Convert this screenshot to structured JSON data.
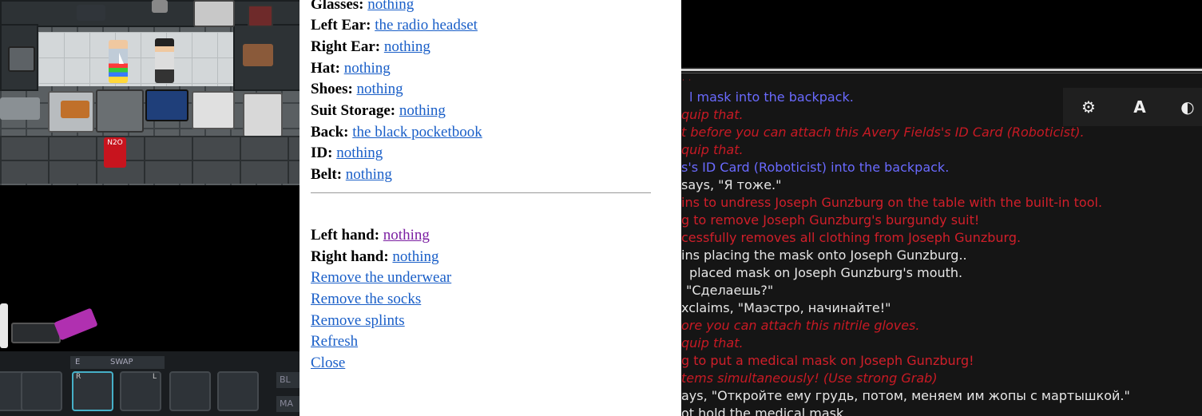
{
  "game": {
    "swap_key": "E",
    "swap_label": "SWAP",
    "tank_label": "N2O",
    "side_labels": [
      "BL",
      "MA"
    ],
    "slot_markers": [
      "R",
      "L"
    ]
  },
  "inventory": {
    "slots": [
      {
        "label": "Glasses:",
        "value": "nothing"
      },
      {
        "label": "Left Ear:",
        "value": "the radio headset"
      },
      {
        "label": "Right Ear:",
        "value": "nothing"
      },
      {
        "label": "Hat:",
        "value": "nothing"
      },
      {
        "label": "Shoes:",
        "value": "nothing"
      },
      {
        "label": "Suit Storage:",
        "value": "nothing"
      },
      {
        "label": "Back:",
        "value": "the black pocketbook"
      },
      {
        "label": "ID:",
        "value": "nothing"
      },
      {
        "label": "Belt:",
        "value": "nothing"
      }
    ],
    "hands": [
      {
        "label": "Left hand:",
        "value": "nothing"
      },
      {
        "label": "Right hand:",
        "value": "nothing"
      }
    ],
    "actions": [
      "Remove the underwear",
      "Remove the socks",
      "Remove splints",
      "Refresh",
      "Close"
    ]
  },
  "chat": {
    "toolbar": {
      "font_label": "A"
    },
    "lines": [
      {
        "text": "l mask into the backpack.",
        "style": "blue"
      },
      {
        "text": "quip that.",
        "style": "redi"
      },
      {
        "text": "t before you can attach this Avery Fields's ID Card (Roboticist).",
        "style": "redi"
      },
      {
        "text": "quip that.",
        "style": "redi"
      },
      {
        "text": "s's ID Card (Roboticist) into the backpack.",
        "style": "blue"
      },
      {
        "text": "says, \"Я тоже.\"",
        "style": "white"
      },
      {
        "text": "ins to undress Joseph Gunzburg on the table with the built-in tool.",
        "style": "red"
      },
      {
        "text": "g to remove Joseph Gunzburg's burgundy suit!",
        "style": "red"
      },
      {
        "text": "cessfully removes all clothing from Joseph Gunzburg.",
        "style": "red"
      },
      {
        "text": "ins placing the mask onto Joseph Gunzburg..",
        "style": "white"
      },
      {
        "text": "placed mask on Joseph Gunzburg's mouth.",
        "style": "white"
      },
      {
        "text": "\"Сделаешь?\"",
        "style": "white"
      },
      {
        "text": "xclaims, \"Маэстро, начинайте!\"",
        "style": "white"
      },
      {
        "text": "ore you can attach this nitrile gloves.",
        "style": "redi"
      },
      {
        "text": "quip that.",
        "style": "redi"
      },
      {
        "text": "g to put a medical mask on Joseph Gunzburg!",
        "style": "red"
      },
      {
        "text": "tems simultaneously! (Use strong Grab)",
        "style": "redi"
      },
      {
        "text": "ays, \"Откройте ему грудь, потом, меняем им жопы с мартышкой.\"",
        "style": "white"
      },
      {
        "text": "ot hold the medical mask.",
        "style": "white"
      }
    ]
  },
  "colors": {
    "link": "#1a5fc8",
    "visited_link": "#7b1fa2",
    "chat_blue": "#6a6aff",
    "chat_red": "#d11f2a"
  }
}
